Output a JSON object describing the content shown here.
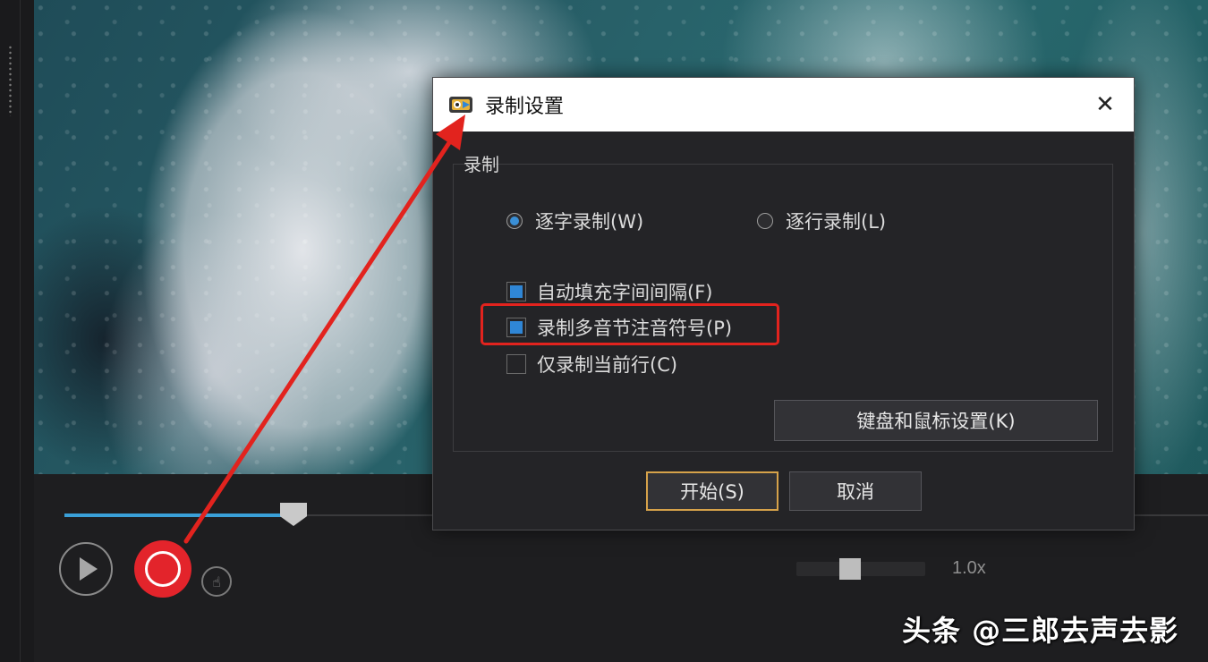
{
  "dialog": {
    "title": "录制设置",
    "close_symbol": "✕",
    "group_label": "录制",
    "radio_char": {
      "label": "逐字录制(W)",
      "selected": true
    },
    "radio_line": {
      "label": "逐行录制(L)",
      "selected": false
    },
    "check_autofill": {
      "label": "自动填充字间间隔(F)",
      "checked": true
    },
    "check_polysyllable": {
      "label": "录制多音节注音符号(P)",
      "checked": true
    },
    "check_current_line": {
      "label": "仅录制当前行(C)",
      "checked": false
    },
    "keyboard_mouse_button": "键盘和鼠标设置(K)",
    "start_button": "开始(S)",
    "cancel_button": "取消"
  },
  "player": {
    "progress": 0.2,
    "speed_label": "1.0x",
    "speed_level": 0.42
  },
  "watermark": "头条 @三郎去声去影",
  "colors": {
    "accent_blue": "#2f86d6",
    "record_red": "#e3242b",
    "annotation_red": "#e2231e",
    "primary_border": "#d6a24a"
  },
  "icons": [
    "play-icon",
    "record-icon",
    "hand-pointer-icon",
    "close-icon",
    "app-icon"
  ]
}
